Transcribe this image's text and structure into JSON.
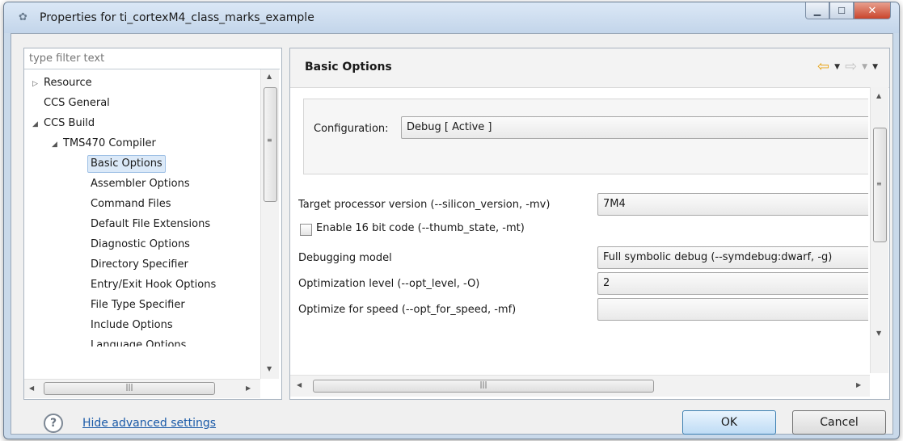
{
  "window": {
    "title": "Properties for ti_cortexM4_class_marks_example",
    "min_glyph": "▁",
    "max_glyph": "☐",
    "close_glyph": "✕"
  },
  "filter": {
    "placeholder": "type filter text"
  },
  "tree": {
    "items": [
      {
        "label": "Resource",
        "arrow": "▷"
      },
      {
        "label": "CCS General",
        "arrow": ""
      },
      {
        "label": "CCS Build",
        "arrow": "◢"
      },
      {
        "label": "TMS470 Compiler",
        "arrow": "◢"
      },
      {
        "label": "Basic Options",
        "selected": true
      },
      {
        "label": "Assembler Options"
      },
      {
        "label": "Command Files"
      },
      {
        "label": "Default File Extensions"
      },
      {
        "label": "Diagnostic Options"
      },
      {
        "label": "Directory Specifier"
      },
      {
        "label": "Entry/Exit Hook Options"
      },
      {
        "label": "File Type Specifier"
      },
      {
        "label": "Include Options"
      },
      {
        "label": "Language Options"
      }
    ]
  },
  "page": {
    "title": "Basic Options",
    "nav_back_glyph": "⇦",
    "nav_forward_glyph": "⇨",
    "menu_glyph": "▼"
  },
  "config": {
    "label": "Configuration:",
    "value": "Debug  [ Active ]"
  },
  "options": {
    "target_label": "Target processor version (--silicon_version, -mv)",
    "target_value": "7M4",
    "enable16_label": "Enable 16 bit code (--thumb_state, -mt)",
    "debug_label": "Debugging model",
    "debug_value": "Full symbolic debug (--symdebug:dwarf, -g)",
    "opt_level_label": "Optimization level (--opt_level, -O)",
    "opt_level_value": "2",
    "opt_speed_label": "Optimize for speed (--opt_for_speed, -mf)",
    "opt_speed_value": ""
  },
  "scroll": {
    "grip": "|||",
    "grip_v": "≡",
    "up": "▲",
    "down": "▼",
    "left": "◀",
    "right": "▶"
  },
  "footer": {
    "help_glyph": "?",
    "hide_advanced": "Hide advanced settings",
    "ok": "OK",
    "cancel": "Cancel"
  }
}
